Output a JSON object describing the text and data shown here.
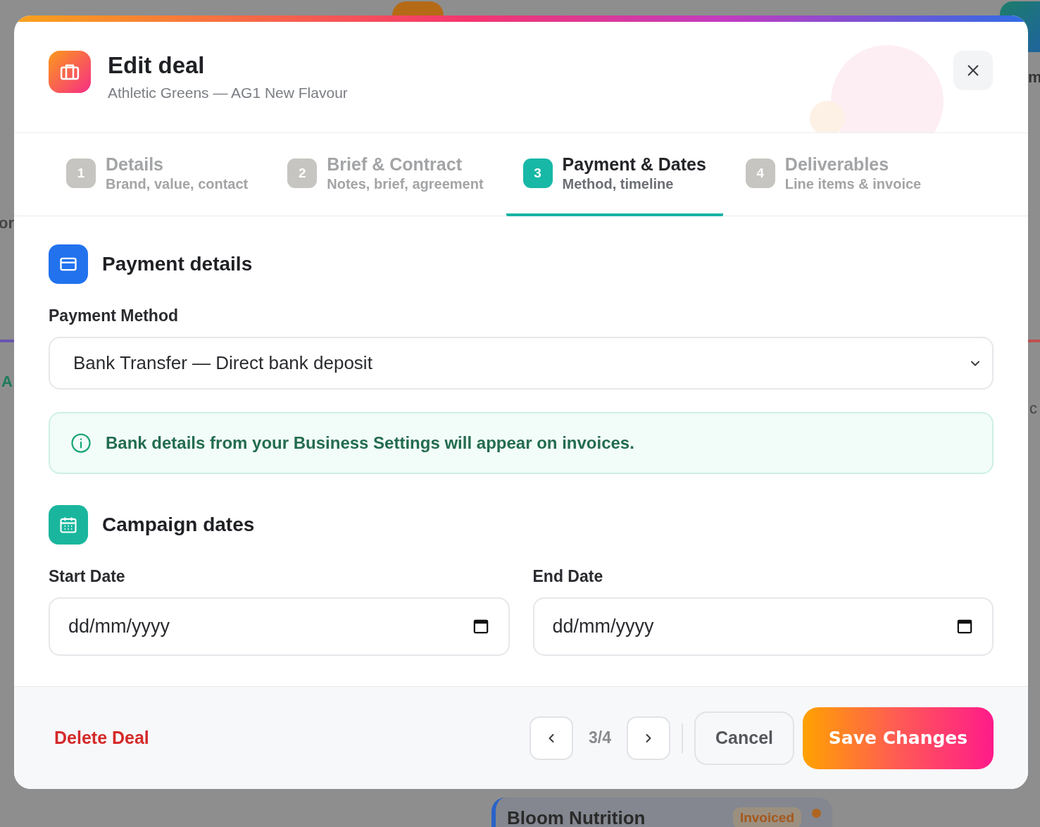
{
  "background": {
    "left_fragments": [
      "or",
      "A"
    ],
    "right_fragments": [
      "m",
      "c"
    ],
    "card": {
      "title": "Bloom Nutrition",
      "status": "Invoiced"
    }
  },
  "dialog": {
    "title": "Edit deal",
    "subtitle": "Athletic Greens — AG1 New Flavour"
  },
  "steps": [
    {
      "number": "1",
      "title": "Details",
      "subtitle": "Brand, value, contact",
      "selected": false
    },
    {
      "number": "2",
      "title": "Brief & Contract",
      "subtitle": "Notes, brief, agreement",
      "selected": false
    },
    {
      "number": "3",
      "title": "Payment & Dates",
      "subtitle": "Method, timeline",
      "selected": true
    },
    {
      "number": "4",
      "title": "Deliverables",
      "subtitle": "Line items & invoice",
      "selected": false
    }
  ],
  "payment": {
    "heading": "Payment details",
    "method_label": "Payment Method",
    "method_value": "Bank Transfer — Direct bank deposit",
    "info": "Bank details from your Business Settings will appear on invoices."
  },
  "dates": {
    "heading": "Campaign dates",
    "fields": [
      {
        "label": "Start Date",
        "placeholder": "dd/mm/yyyy"
      },
      {
        "label": "End Date",
        "placeholder": "dd/mm/yyyy"
      }
    ]
  },
  "footer": {
    "delete": "Delete Deal",
    "page": "3/4",
    "cancel": "Cancel",
    "save": "Save Changes"
  }
}
